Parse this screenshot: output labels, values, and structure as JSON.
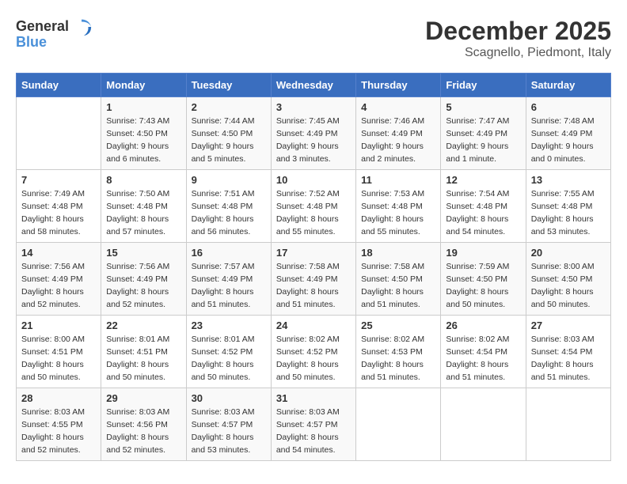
{
  "logo": {
    "text_general": "General",
    "text_blue": "Blue"
  },
  "title": "December 2025",
  "location": "Scagnello, Piedmont, Italy",
  "days_of_week": [
    "Sunday",
    "Monday",
    "Tuesday",
    "Wednesday",
    "Thursday",
    "Friday",
    "Saturday"
  ],
  "weeks": [
    [
      {
        "day": "",
        "sunrise": "",
        "sunset": "",
        "daylight": ""
      },
      {
        "day": "1",
        "sunrise": "Sunrise: 7:43 AM",
        "sunset": "Sunset: 4:50 PM",
        "daylight": "Daylight: 9 hours and 6 minutes."
      },
      {
        "day": "2",
        "sunrise": "Sunrise: 7:44 AM",
        "sunset": "Sunset: 4:50 PM",
        "daylight": "Daylight: 9 hours and 5 minutes."
      },
      {
        "day": "3",
        "sunrise": "Sunrise: 7:45 AM",
        "sunset": "Sunset: 4:49 PM",
        "daylight": "Daylight: 9 hours and 3 minutes."
      },
      {
        "day": "4",
        "sunrise": "Sunrise: 7:46 AM",
        "sunset": "Sunset: 4:49 PM",
        "daylight": "Daylight: 9 hours and 2 minutes."
      },
      {
        "day": "5",
        "sunrise": "Sunrise: 7:47 AM",
        "sunset": "Sunset: 4:49 PM",
        "daylight": "Daylight: 9 hours and 1 minute."
      },
      {
        "day": "6",
        "sunrise": "Sunrise: 7:48 AM",
        "sunset": "Sunset: 4:49 PM",
        "daylight": "Daylight: 9 hours and 0 minutes."
      }
    ],
    [
      {
        "day": "7",
        "sunrise": "Sunrise: 7:49 AM",
        "sunset": "Sunset: 4:48 PM",
        "daylight": "Daylight: 8 hours and 58 minutes."
      },
      {
        "day": "8",
        "sunrise": "Sunrise: 7:50 AM",
        "sunset": "Sunset: 4:48 PM",
        "daylight": "Daylight: 8 hours and 57 minutes."
      },
      {
        "day": "9",
        "sunrise": "Sunrise: 7:51 AM",
        "sunset": "Sunset: 4:48 PM",
        "daylight": "Daylight: 8 hours and 56 minutes."
      },
      {
        "day": "10",
        "sunrise": "Sunrise: 7:52 AM",
        "sunset": "Sunset: 4:48 PM",
        "daylight": "Daylight: 8 hours and 55 minutes."
      },
      {
        "day": "11",
        "sunrise": "Sunrise: 7:53 AM",
        "sunset": "Sunset: 4:48 PM",
        "daylight": "Daylight: 8 hours and 55 minutes."
      },
      {
        "day": "12",
        "sunrise": "Sunrise: 7:54 AM",
        "sunset": "Sunset: 4:48 PM",
        "daylight": "Daylight: 8 hours and 54 minutes."
      },
      {
        "day": "13",
        "sunrise": "Sunrise: 7:55 AM",
        "sunset": "Sunset: 4:48 PM",
        "daylight": "Daylight: 8 hours and 53 minutes."
      }
    ],
    [
      {
        "day": "14",
        "sunrise": "Sunrise: 7:56 AM",
        "sunset": "Sunset: 4:49 PM",
        "daylight": "Daylight: 8 hours and 52 minutes."
      },
      {
        "day": "15",
        "sunrise": "Sunrise: 7:56 AM",
        "sunset": "Sunset: 4:49 PM",
        "daylight": "Daylight: 8 hours and 52 minutes."
      },
      {
        "day": "16",
        "sunrise": "Sunrise: 7:57 AM",
        "sunset": "Sunset: 4:49 PM",
        "daylight": "Daylight: 8 hours and 51 minutes."
      },
      {
        "day": "17",
        "sunrise": "Sunrise: 7:58 AM",
        "sunset": "Sunset: 4:49 PM",
        "daylight": "Daylight: 8 hours and 51 minutes."
      },
      {
        "day": "18",
        "sunrise": "Sunrise: 7:58 AM",
        "sunset": "Sunset: 4:50 PM",
        "daylight": "Daylight: 8 hours and 51 minutes."
      },
      {
        "day": "19",
        "sunrise": "Sunrise: 7:59 AM",
        "sunset": "Sunset: 4:50 PM",
        "daylight": "Daylight: 8 hours and 50 minutes."
      },
      {
        "day": "20",
        "sunrise": "Sunrise: 8:00 AM",
        "sunset": "Sunset: 4:50 PM",
        "daylight": "Daylight: 8 hours and 50 minutes."
      }
    ],
    [
      {
        "day": "21",
        "sunrise": "Sunrise: 8:00 AM",
        "sunset": "Sunset: 4:51 PM",
        "daylight": "Daylight: 8 hours and 50 minutes."
      },
      {
        "day": "22",
        "sunrise": "Sunrise: 8:01 AM",
        "sunset": "Sunset: 4:51 PM",
        "daylight": "Daylight: 8 hours and 50 minutes."
      },
      {
        "day": "23",
        "sunrise": "Sunrise: 8:01 AM",
        "sunset": "Sunset: 4:52 PM",
        "daylight": "Daylight: 8 hours and 50 minutes."
      },
      {
        "day": "24",
        "sunrise": "Sunrise: 8:02 AM",
        "sunset": "Sunset: 4:52 PM",
        "daylight": "Daylight: 8 hours and 50 minutes."
      },
      {
        "day": "25",
        "sunrise": "Sunrise: 8:02 AM",
        "sunset": "Sunset: 4:53 PM",
        "daylight": "Daylight: 8 hours and 51 minutes."
      },
      {
        "day": "26",
        "sunrise": "Sunrise: 8:02 AM",
        "sunset": "Sunset: 4:54 PM",
        "daylight": "Daylight: 8 hours and 51 minutes."
      },
      {
        "day": "27",
        "sunrise": "Sunrise: 8:03 AM",
        "sunset": "Sunset: 4:54 PM",
        "daylight": "Daylight: 8 hours and 51 minutes."
      }
    ],
    [
      {
        "day": "28",
        "sunrise": "Sunrise: 8:03 AM",
        "sunset": "Sunset: 4:55 PM",
        "daylight": "Daylight: 8 hours and 52 minutes."
      },
      {
        "day": "29",
        "sunrise": "Sunrise: 8:03 AM",
        "sunset": "Sunset: 4:56 PM",
        "daylight": "Daylight: 8 hours and 52 minutes."
      },
      {
        "day": "30",
        "sunrise": "Sunrise: 8:03 AM",
        "sunset": "Sunset: 4:57 PM",
        "daylight": "Daylight: 8 hours and 53 minutes."
      },
      {
        "day": "31",
        "sunrise": "Sunrise: 8:03 AM",
        "sunset": "Sunset: 4:57 PM",
        "daylight": "Daylight: 8 hours and 54 minutes."
      },
      {
        "day": "",
        "sunrise": "",
        "sunset": "",
        "daylight": ""
      },
      {
        "day": "",
        "sunrise": "",
        "sunset": "",
        "daylight": ""
      },
      {
        "day": "",
        "sunrise": "",
        "sunset": "",
        "daylight": ""
      }
    ]
  ]
}
